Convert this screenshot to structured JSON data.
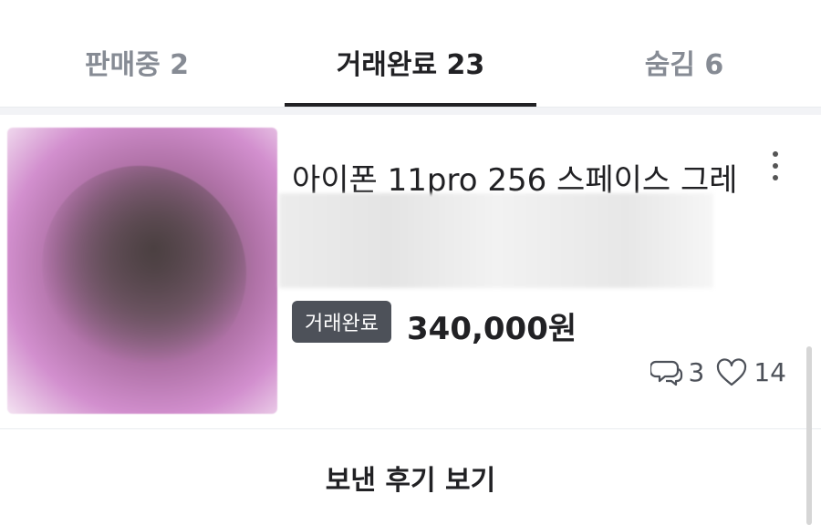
{
  "tabs": [
    {
      "label": "판매중 2",
      "active": false
    },
    {
      "label": "거래완료 23",
      "active": true
    },
    {
      "label": "숨김 6",
      "active": false
    }
  ],
  "item": {
    "title": "아이폰 11pro 256 스페이스 그레",
    "status_badge": "거래완료",
    "price": "340,000원",
    "chat_count": "3",
    "like_count": "14",
    "icons": {
      "more": "more-vertical-icon",
      "chat": "chat-bubbles-icon",
      "like": "heart-icon"
    }
  },
  "actions": {
    "review_label": "보낸 후기 보기"
  },
  "colors": {
    "active_text": "#212124",
    "inactive_text": "#868b94",
    "badge_bg": "#4d5159"
  }
}
